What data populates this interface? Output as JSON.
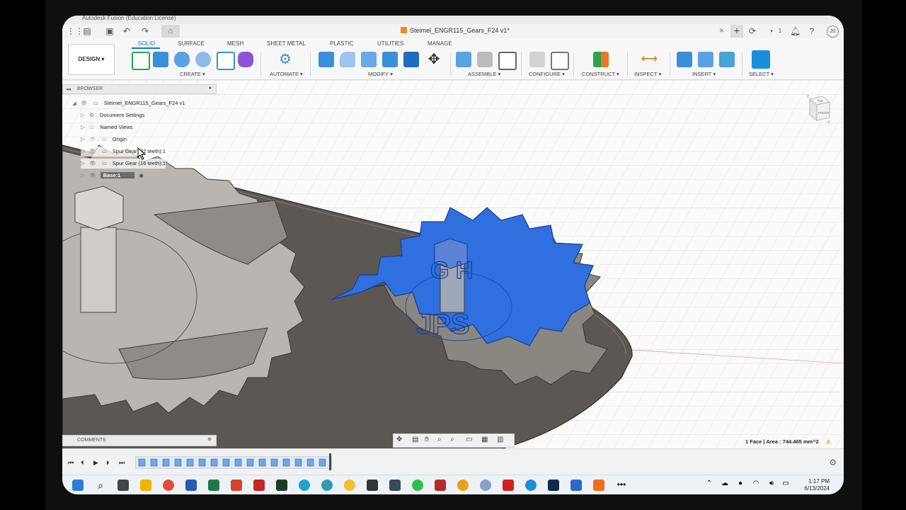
{
  "os_window": {
    "title": "Autodesk Fusion (Education License)"
  },
  "app_header": {
    "document_title": "Steimel_ENGR115_Gears_F24 v1*",
    "close_glyph": "×",
    "new_tab_glyph": "+",
    "notification_count": "1",
    "user_initials": "JS"
  },
  "ribbon": {
    "workspace_button": "DESIGN ▾",
    "tabs": [
      "SOLID",
      "SURFACE",
      "MESH",
      "SHEET METAL",
      "PLASTIC",
      "UTILITIES",
      "MANAGE"
    ],
    "active_tab": "SOLID",
    "groups": [
      "CREATE ▾",
      "AUTOMATE ▾",
      "MODIFY ▾",
      "ASSEMBLE ▾",
      "CONFIGURE ▾",
      "CONSTRUCT ▾",
      "INSPECT ▾",
      "INSERT ▾",
      "SELECT ▾"
    ],
    "accent_color": "#1a74c7"
  },
  "browser": {
    "header": "BROWSER",
    "collapse_glyph": "◂◂",
    "root": "Steimel_ENGR115_Gears_F24 v1",
    "items": [
      {
        "label": "Document Settings"
      },
      {
        "label": "Named Views"
      },
      {
        "label": "Origin"
      },
      {
        "label": "Spur Gear (32 teeth):1"
      },
      {
        "label": "Spur Gear (16 teeth):1"
      },
      {
        "label": "Base:1"
      }
    ]
  },
  "viewcube": {
    "top": "TOP",
    "front": "FRONT",
    "axis_x": "X",
    "axis_z": "Z"
  },
  "comments": {
    "label": "COMMENTS"
  },
  "status": {
    "selection": "1 Face | Area : 744.465 mm^2"
  },
  "model_text": {
    "emboss_top": "G H",
    "emboss_bottom": "JPS"
  },
  "colors": {
    "selection_blue": "#2f6fe0",
    "gear_gray": "#b9b5b0",
    "base_dark": "#5b5854"
  },
  "taskbar": {
    "time": "1:17 PM",
    "date": "6/13/2024"
  }
}
